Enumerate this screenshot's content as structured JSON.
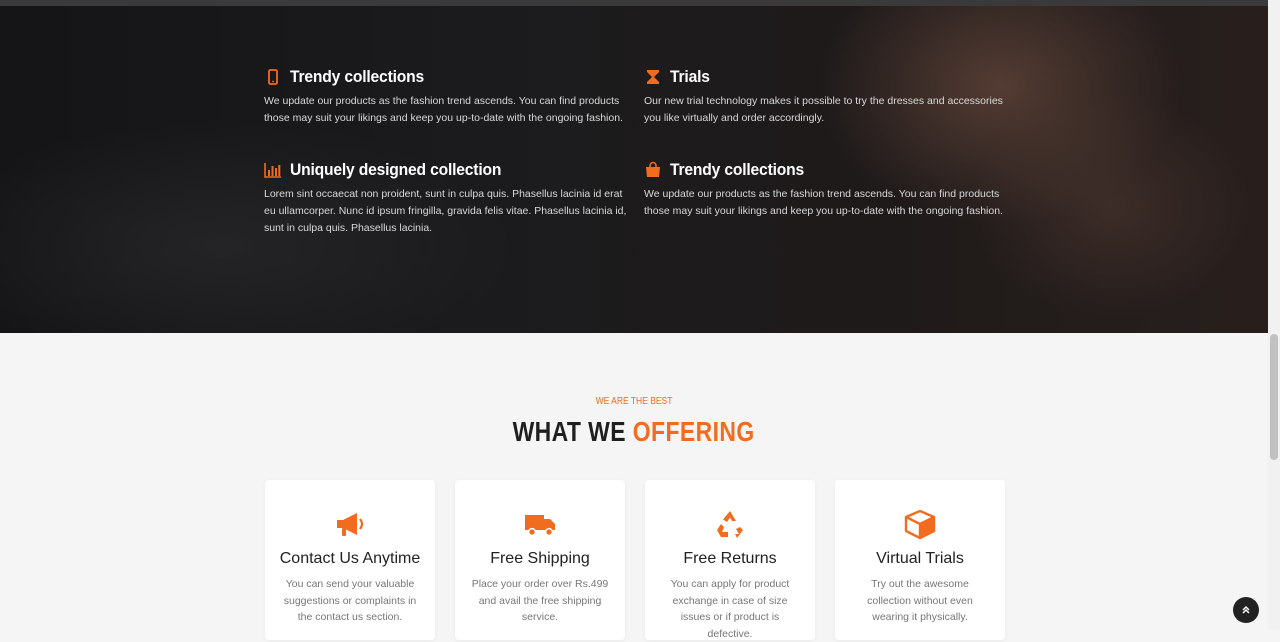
{
  "features": [
    {
      "title": "Trendy collections",
      "icon": "mobile-icon",
      "desc": "We update our products as the fashion trend ascends. You can find products those may suit your likings and keep you up-to-date with the ongoing fashion."
    },
    {
      "title": "Trials",
      "icon": "hourglass-icon",
      "desc": "Our new trial technology makes it possible to try the dresses and accessories you like virtually and order accordingly."
    },
    {
      "title": "Uniquely designed collection",
      "icon": "bar-chart-icon",
      "desc": "Lorem sint occaecat non proident, sunt in culpa quis. Phasellus lacinia id erat eu ullamcorper. Nunc id ipsum fringilla, gravida felis vitae. Phasellus lacinia id, sunt in culpa quis. Phasellus lacinia."
    },
    {
      "title": "Trendy collections",
      "icon": "shopping-bag-icon",
      "desc": "We update our products as the fashion trend ascends. You can find products those may suit your likings and keep you up-to-date with the ongoing fashion."
    }
  ],
  "offering": {
    "eyebrow": "WE ARE THE BEST",
    "heading_part1": "WHAT WE ",
    "heading_part2": "OFFERING",
    "cards": [
      {
        "title": "Contact Us Anytime",
        "icon": "megaphone-icon",
        "desc": "You can send your valuable suggestions or complaints in the contact us section."
      },
      {
        "title": "Free Shipping",
        "icon": "truck-icon",
        "desc": "Place your order over Rs.499 and avail the free shipping service."
      },
      {
        "title": "Free Returns",
        "icon": "recycle-icon",
        "desc": "You can apply for product exchange in case of size issues or if product is defective."
      },
      {
        "title": "Virtual Trials",
        "icon": "cube-icon",
        "desc": "Try out the awesome collection without even wearing it physically."
      }
    ]
  },
  "colors": {
    "accent": "#f26c1f",
    "dark": "#1f1f1f"
  }
}
